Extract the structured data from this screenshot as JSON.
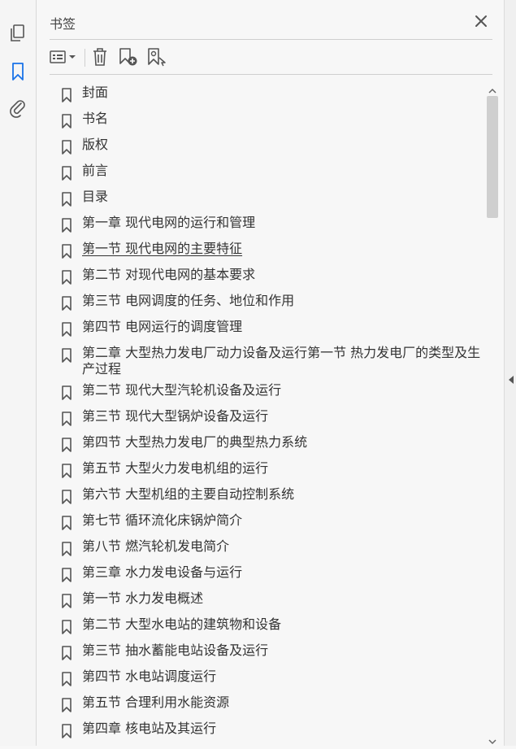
{
  "left_rail": {
    "buttons": [
      {
        "name": "pages-icon"
      },
      {
        "name": "bookmarks-icon",
        "active": true
      },
      {
        "name": "attachments-icon"
      }
    ]
  },
  "panel": {
    "title": "书签",
    "toolbar": [
      {
        "name": "options-menu-icon"
      },
      {
        "name": "delete-icon"
      },
      {
        "name": "new-bookmark-icon"
      },
      {
        "name": "bookmark-from-structure-icon"
      }
    ]
  },
  "colors": {
    "active": "#1a73e8",
    "icon": "#555555",
    "text": "#333333"
  },
  "bookmarks": [
    {
      "label": "封面"
    },
    {
      "label": "书名"
    },
    {
      "label": "版权"
    },
    {
      "label": "前言"
    },
    {
      "label": "目录"
    },
    {
      "label": "第一章  现代电网的运行和管理"
    },
    {
      "label": "第一节  现代电网的主要特征",
      "selected": true
    },
    {
      "label": "第二节  对现代电网的基本要求"
    },
    {
      "label": "第三节  电网调度的任务、地位和作用"
    },
    {
      "label": "第四节  电网运行的调度管理"
    },
    {
      "label": "第二章  大型热力发电厂动力设备及运行第一节  热力发电厂的类型及生产过程"
    },
    {
      "label": "第二节  现代大型汽轮机设备及运行"
    },
    {
      "label": "第三节  现代大型锅炉设备及运行"
    },
    {
      "label": "第四节  大型热力发电厂的典型热力系统"
    },
    {
      "label": "第五节  大型火力发电机组的运行"
    },
    {
      "label": "第六节  大型机组的主要自动控制系统"
    },
    {
      "label": "第七节  循环流化床锅炉简介"
    },
    {
      "label": "第八节  燃汽轮机发电简介"
    },
    {
      "label": "第三章  水力发电设备与运行"
    },
    {
      "label": "第一节  水力发电概述"
    },
    {
      "label": "第二节  大型水电站的建筑物和设备"
    },
    {
      "label": "第三节  抽水蓄能电站设备及运行"
    },
    {
      "label": "第四节  水电站调度运行"
    },
    {
      "label": "第五节  合理利用水能资源"
    },
    {
      "label": "第四章  核电站及其运行"
    }
  ]
}
